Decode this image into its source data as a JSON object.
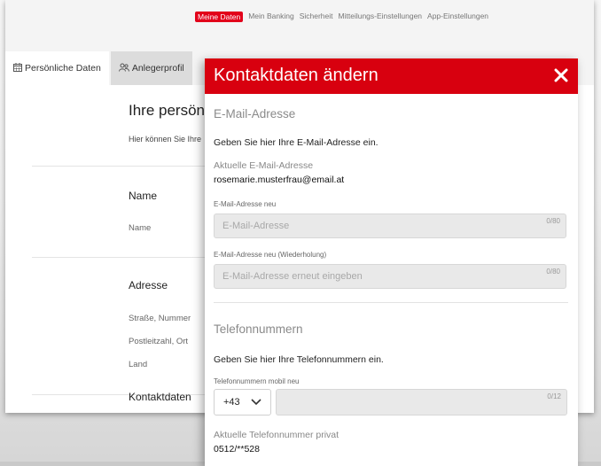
{
  "topnav": {
    "items": [
      "Meine Daten",
      "Mein Banking",
      "Sicherheit",
      "Mitteilungs-Einstellungen",
      "App-Einstellungen"
    ],
    "active_color": "#e2001a"
  },
  "tabs": [
    {
      "label": "Persönliche Daten",
      "icon": "calendar-icon"
    },
    {
      "label": "Anlegerprofil",
      "icon": "users-icon"
    }
  ],
  "background": {
    "title": "Ihre persönli",
    "subtitle": "Hier können Sie Ihre",
    "sections": {
      "name": {
        "heading": "Name",
        "labels": [
          "Name"
        ]
      },
      "adresse": {
        "heading": "Adresse",
        "labels": [
          "Straße, Nummer",
          "Postleitzahl, Ort",
          "Land"
        ]
      },
      "kontakt": {
        "heading": "Kontaktdaten"
      }
    }
  },
  "modal": {
    "title": "Kontaktdaten ändern",
    "close_icon": "close-icon",
    "header_color": "#d8000f",
    "email": {
      "heading": "E-Mail-Adresse",
      "instruction": "Geben Sie hier Ihre E-Mail-Adresse ein.",
      "current_label": "Aktuelle E-Mail-Adresse",
      "current_value": "rosemarie.musterfrau@email.at",
      "new_label": "E-Mail-Adresse neu",
      "new_placeholder": "E-Mail-Adresse",
      "new_counter": "0/80",
      "repeat_label": "E-Mail-Adresse neu (Wiederholung)",
      "repeat_placeholder": "E-Mail-Adresse erneut eingeben",
      "repeat_counter": "0/80"
    },
    "phone": {
      "heading": "Telefonnummern",
      "instruction": "Geben Sie hier Ihre Telefonnummern ein.",
      "mobile_label": "Telefonnummern mobil neu",
      "prefix_value": "+43",
      "mobile_counter": "0/12",
      "current_private_label": "Aktuelle Telefonnummer privat",
      "current_private_value": "0512/**528"
    }
  }
}
